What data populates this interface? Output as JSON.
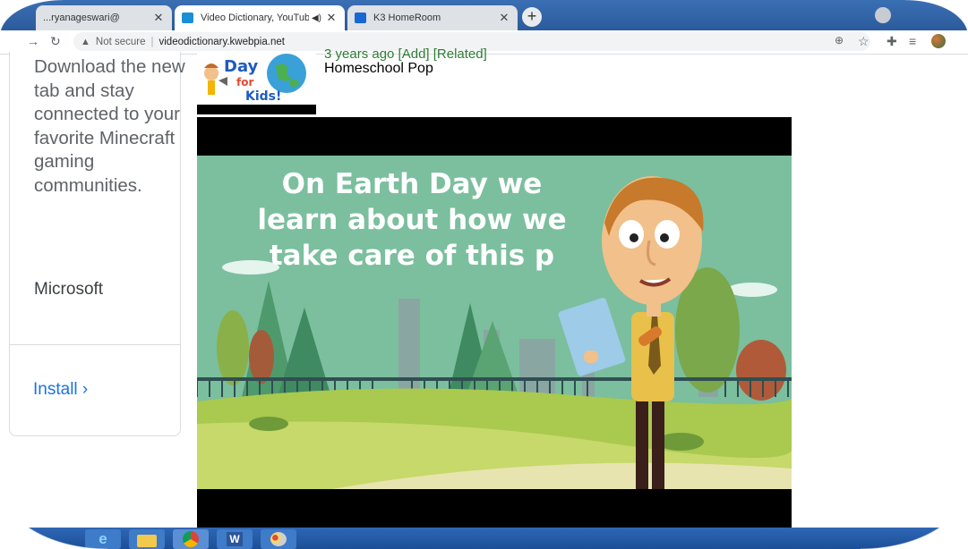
{
  "browser": {
    "tabs": [
      {
        "label": "...ryanageswari@",
        "close": "✕"
      },
      {
        "label": "Video Dictionary, YouTube D",
        "audio_icon": "speaker-icon",
        "close": "✕"
      },
      {
        "label": "K3 HomeRoom",
        "close": "✕"
      }
    ],
    "new_tab": "+",
    "url_warning": "Not secure",
    "url": "videodictionary.kwebpia.net"
  },
  "ad": {
    "text": "Download the new tab and stay connected to your favorite Minecraft gaming communities.",
    "brand": "Microsoft",
    "install": "Install ›"
  },
  "result": {
    "meta": "3 years ago  [Add]  [Related]",
    "channel": "Homeschool Pop",
    "thumbnail_text": "Day for Kids!"
  },
  "video": {
    "caption": "On Earth Day we learn about how we take care of this p"
  },
  "colors": {
    "tab_strip": "#2c5b9c",
    "install_link": "#1a73e8",
    "meta_green": "#2e7d32",
    "sky": "#7bbf9e"
  }
}
